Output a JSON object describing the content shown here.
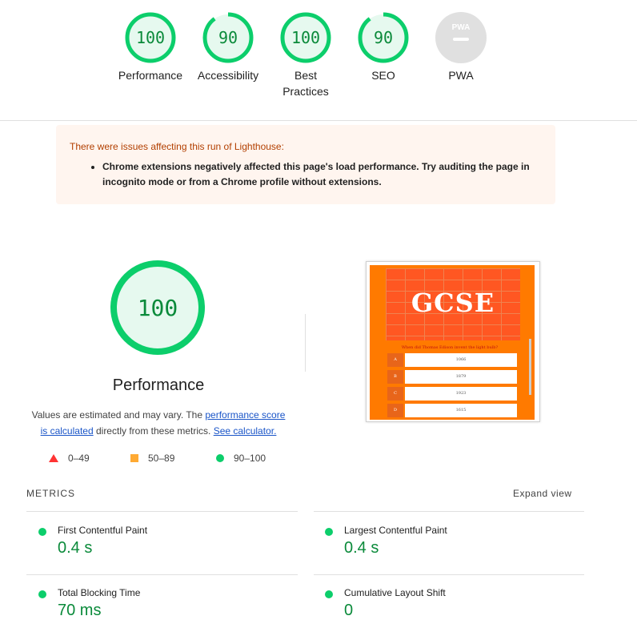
{
  "colors": {
    "pass": "#0cce6b",
    "pass_text": "#0a8a3a",
    "average": "#ffaa33",
    "fail": "#ff3333",
    "pwa_gray": "#e0e0e0"
  },
  "categories": [
    {
      "label": "Performance",
      "score": "100",
      "value": 1.0
    },
    {
      "label": "Accessibility",
      "score": "90",
      "value": 0.9
    },
    {
      "label": "Best Practices",
      "score": "100",
      "value": 1.0
    },
    {
      "label": "SEO",
      "score": "90",
      "value": 0.9
    },
    {
      "label": "PWA",
      "score": "PWA",
      "value": null
    }
  ],
  "warning": {
    "title": "There were issues affecting this run of Lighthouse:",
    "items": [
      "Chrome extensions negatively affected this page's load performance. Try auditing the page in incognito mode or from a Chrome profile without extensions."
    ]
  },
  "performance": {
    "score": "100",
    "title": "Performance",
    "desc_prefix": "Values are estimated and may vary. The ",
    "desc_link1": "performance score is calculated",
    "desc_middle": " directly from these metrics. ",
    "desc_link2": "See calculator."
  },
  "legend": [
    {
      "icon": "triangle-icon",
      "label": "0–49"
    },
    {
      "icon": "square-icon",
      "label": "50–89"
    },
    {
      "icon": "circle-icon",
      "label": "90–100"
    }
  ],
  "thumbnail": {
    "logo": "GCSE",
    "question": "When did Thomas Edison invent the light bulb?",
    "answers": [
      {
        "letter": "A",
        "text": "1066"
      },
      {
        "letter": "B",
        "text": "1879"
      },
      {
        "letter": "C",
        "text": "1923"
      },
      {
        "letter": "D",
        "text": "1615"
      }
    ]
  },
  "metrics": {
    "header": "METRICS",
    "expand_label": "Expand view",
    "items": [
      {
        "name": "First Contentful Paint",
        "value": "0.4 s"
      },
      {
        "name": "Largest Contentful Paint",
        "value": "0.4 s"
      },
      {
        "name": "Total Blocking Time",
        "value": "70 ms"
      },
      {
        "name": "Cumulative Layout Shift",
        "value": "0"
      }
    ]
  }
}
